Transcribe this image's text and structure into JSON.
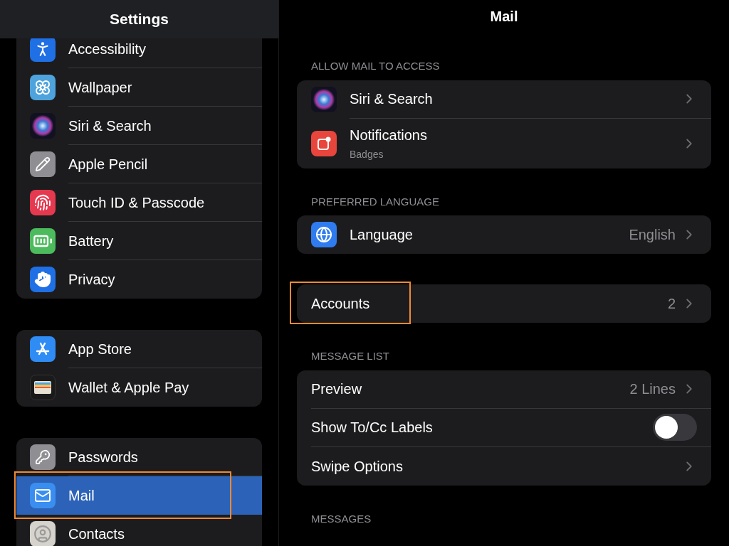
{
  "sidebar": {
    "title": "Settings",
    "groups": [
      {
        "items": [
          {
            "label": "Accessibility",
            "selected": false,
            "highlighted": false
          },
          {
            "label": "Wallpaper",
            "selected": false,
            "highlighted": false
          },
          {
            "label": "Siri & Search",
            "selected": false,
            "highlighted": false
          },
          {
            "label": "Apple Pencil",
            "selected": false,
            "highlighted": false
          },
          {
            "label": "Touch ID & Passcode",
            "selected": false,
            "highlighted": false
          },
          {
            "label": "Battery",
            "selected": false,
            "highlighted": false
          },
          {
            "label": "Privacy",
            "selected": false,
            "highlighted": false
          }
        ]
      },
      {
        "items": [
          {
            "label": "App Store",
            "selected": false,
            "highlighted": false
          },
          {
            "label": "Wallet & Apple Pay",
            "selected": false,
            "highlighted": false
          }
        ]
      },
      {
        "items": [
          {
            "label": "Passwords",
            "selected": false,
            "highlighted": false
          },
          {
            "label": "Mail",
            "selected": true,
            "highlighted": true
          },
          {
            "label": "Contacts",
            "selected": false,
            "highlighted": false
          }
        ]
      }
    ]
  },
  "detail": {
    "title": "Mail",
    "sections": [
      {
        "header": "ALLOW MAIL TO ACCESS",
        "rows": [
          {
            "kind": "link",
            "label": "Siri & Search",
            "highlighted": false
          },
          {
            "kind": "link",
            "label": "Notifications",
            "subtitle": "Badges",
            "highlighted": false
          }
        ]
      },
      {
        "header": "PREFERRED LANGUAGE",
        "rows": [
          {
            "kind": "link",
            "label": "Language",
            "value": "English",
            "highlighted": false
          }
        ]
      },
      {
        "rows": [
          {
            "kind": "link",
            "label": "Accounts",
            "value": "2",
            "highlighted": true
          }
        ]
      },
      {
        "header": "MESSAGE LIST",
        "rows": [
          {
            "kind": "link",
            "label": "Preview",
            "value": "2 Lines",
            "highlighted": false
          },
          {
            "kind": "toggle",
            "label": "Show To/Cc Labels",
            "on": false,
            "highlighted": false
          },
          {
            "kind": "link",
            "label": "Swipe Options",
            "highlighted": false
          }
        ]
      },
      {
        "header": "MESSAGES"
      }
    ]
  }
}
